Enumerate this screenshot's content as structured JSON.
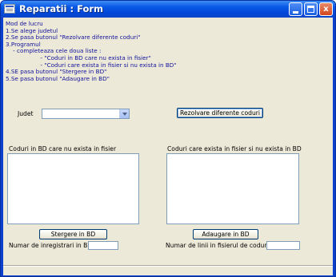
{
  "window": {
    "title": "Reparatii : Form",
    "minimize_label": "",
    "maximize_label": "",
    "close_label": "x"
  },
  "instructions": {
    "text": "Mod de lucru\n1.Se alege judetul\n2.Se pasa butonul \"Rezolvare diferente coduri\"\n3.Programul\n    - completeaza cele doua liste :\n                   - \"Coduri in BD care nu exista in fisier\"\n                   - \"Coduri care exista in fisier si nu exista in BD\"\n4.SE pasa butonul \"Stergere in BD\"\n5.Se pasa butonul \"Adaugare in BD\""
  },
  "judet": {
    "label": "Judet",
    "value": ""
  },
  "resolve_button": {
    "label": "Rezolvare diferente coduri"
  },
  "left_panel": {
    "header": "Coduri in  BD care nu exista in fisier",
    "items": [],
    "delete_button": "Stergere in BD",
    "count_label": "Numar de inregistrari in BD:",
    "count_value": ""
  },
  "right_panel": {
    "header": "Coduri care exista in fisier si nu exista in BD",
    "items": [],
    "add_button": "Adaugare in BD",
    "count_label": "Numar de linii in fisierul de coduri:",
    "count_value": ""
  },
  "colors": {
    "titlebar": "#0a5ae8",
    "client_bg": "#ece9d8",
    "instructions_text": "#13139c"
  }
}
